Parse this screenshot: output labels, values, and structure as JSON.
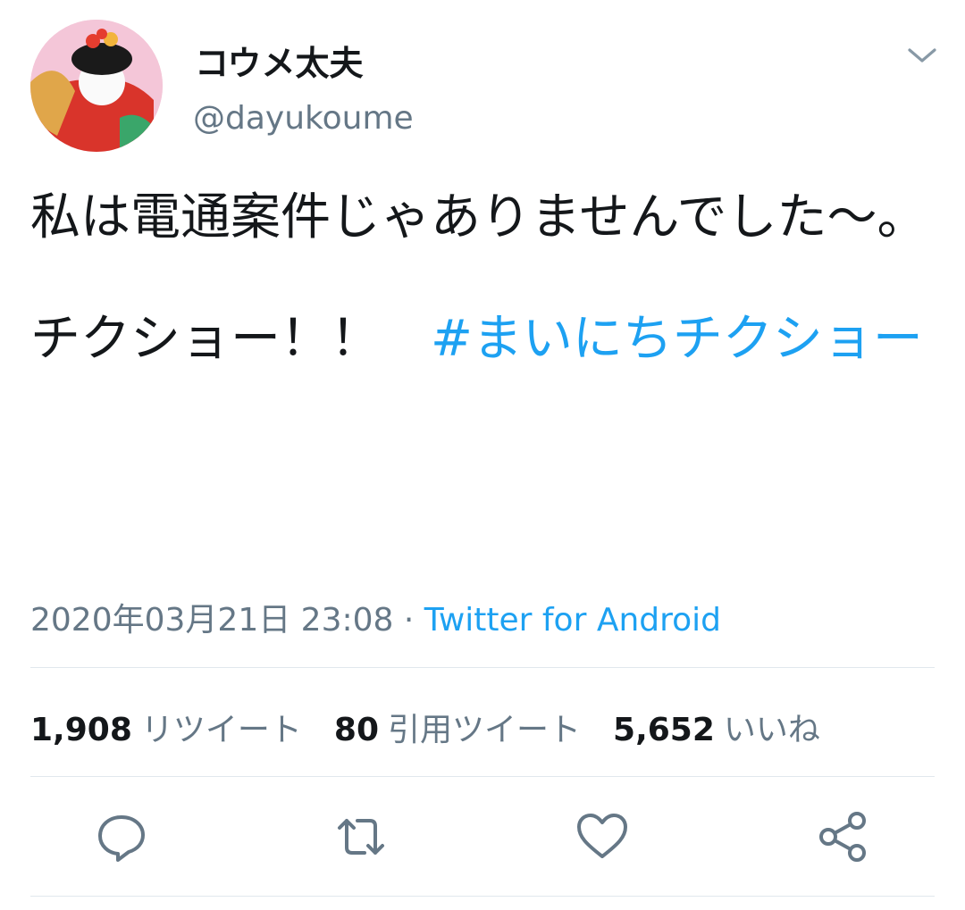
{
  "user": {
    "display_name": "コウメ太夫",
    "handle": "@dayukoume"
  },
  "tweet": {
    "text": "私は電通案件じゃありませんでした〜。\n\nチクショー！！　",
    "hashtag": "#まいにちチクショー"
  },
  "meta": {
    "timestamp": "2020年03月21日 23:08",
    "separator": " · ",
    "source": "Twitter for Android"
  },
  "stats": {
    "retweets_count": "1,908",
    "retweets_label": "リツイート",
    "quotes_count": "80",
    "quotes_label": "引用ツイート",
    "likes_count": "5,652",
    "likes_label": "いいね"
  },
  "icons": {
    "more": "chevron-down-icon",
    "reply": "reply-icon",
    "retweet": "retweet-icon",
    "like": "heart-icon",
    "share": "share-icon"
  },
  "colors": {
    "link": "#1da1f2",
    "secondary_text": "#657786",
    "divider": "#e1e8ed"
  }
}
